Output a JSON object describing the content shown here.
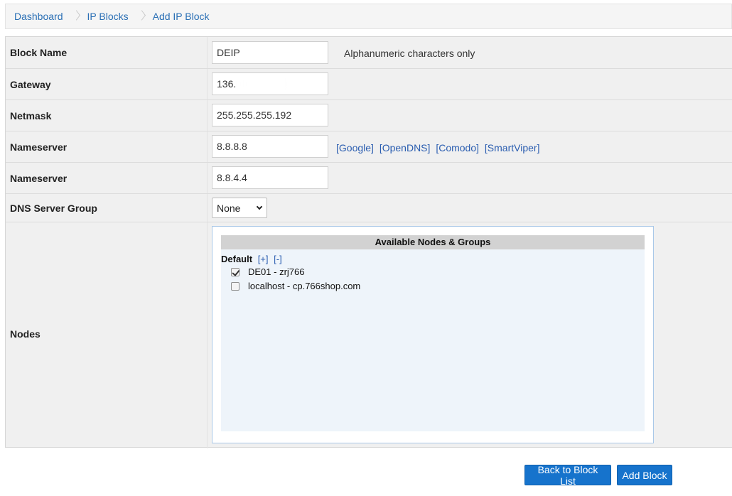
{
  "breadcrumb": [
    "Dashboard",
    "IP Blocks",
    "Add IP Block"
  ],
  "form": {
    "block_name": {
      "label": "Block Name",
      "value": "DEIP",
      "hint": "Alphanumeric characters only"
    },
    "gateway": {
      "label": "Gateway",
      "value": "136."
    },
    "netmask": {
      "label": "Netmask",
      "value": "255.255.255.192"
    },
    "nameserver1": {
      "label": "Nameserver",
      "value": "8.8.8.8",
      "presets": [
        "[Google]",
        "[OpenDNS]",
        "[Comodo]",
        "[SmartViper]"
      ]
    },
    "nameserver2": {
      "label": "Nameserver",
      "value": "8.8.4.4"
    },
    "dns_group": {
      "label": "DNS Server Group",
      "selected": "None"
    },
    "nodes": {
      "label": "Nodes",
      "panel_title": "Available Nodes & Groups",
      "group_name": "Default",
      "expand": "[+]",
      "collapse": "[-]",
      "items": [
        {
          "label": "DE01 - zrj766",
          "checked": true
        },
        {
          "label": "localhost - cp.766shop.com",
          "checked": false
        }
      ]
    }
  },
  "buttons": {
    "back": "Back to Block List",
    "add": "Add Block"
  },
  "colors": {
    "primary_button": "#1673cc",
    "link": "#2a5db0",
    "panel_bg": "#f0f0f0"
  }
}
